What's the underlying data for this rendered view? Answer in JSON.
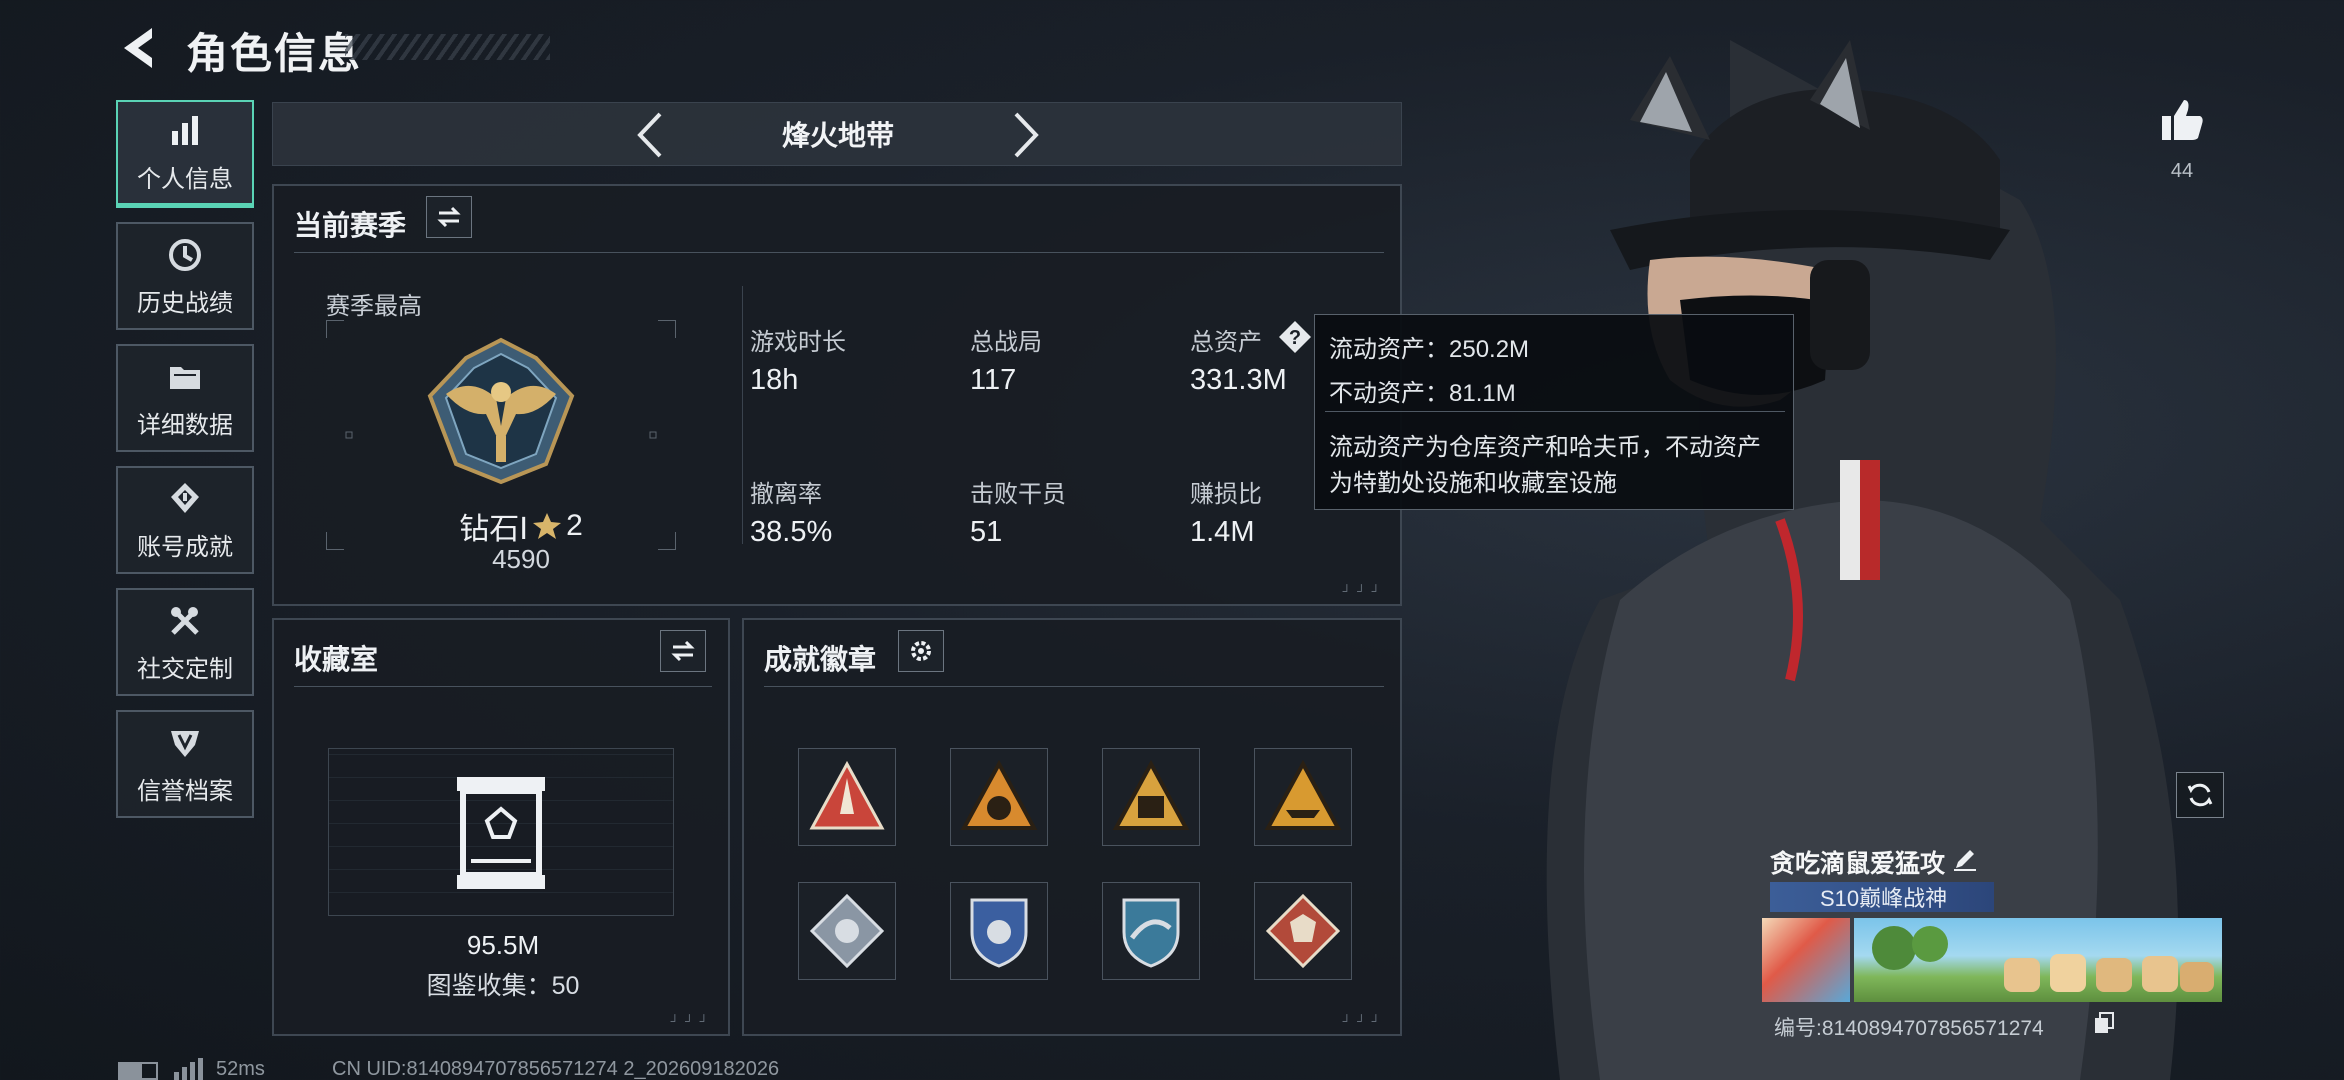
{
  "header": {
    "title": "角色信息"
  },
  "sidebar": {
    "items": [
      {
        "label": "个人信息",
        "icon": "bar-chart-icon",
        "active": true
      },
      {
        "label": "历史战绩",
        "icon": "clock-icon",
        "active": false
      },
      {
        "label": "详细数据",
        "icon": "folder-icon",
        "active": false
      },
      {
        "label": "账号成就",
        "icon": "medal-icon",
        "active": false
      },
      {
        "label": "社交定制",
        "icon": "tools-icon",
        "active": false
      },
      {
        "label": "信誉档案",
        "icon": "shield-icon",
        "active": false
      }
    ]
  },
  "mode_nav": {
    "title": "烽火地带"
  },
  "season": {
    "heading": "当前赛季",
    "best_label": "赛季最高",
    "rank_name": "钻石Ⅰ",
    "rank_stars": "2",
    "rank_score": "4590",
    "stats": [
      {
        "label": "游戏时长",
        "value": "18h"
      },
      {
        "label": "总战局",
        "value": "117"
      },
      {
        "label": "总资产",
        "value": "331.3M"
      },
      {
        "label": "撤离率",
        "value": "38.5%"
      },
      {
        "label": "击败干员",
        "value": "51"
      },
      {
        "label": "赚损比",
        "value": "1.4M"
      }
    ]
  },
  "tooltip": {
    "liquid": "流动资产：250.2M",
    "fixed": "不动资产：81.1M",
    "desc_line1": "流动资产为仓库资产和哈夫币，不动资产",
    "desc_line2": "为特勤处设施和收藏室设施"
  },
  "collection": {
    "heading": "收藏室",
    "value": "95.5M",
    "catalog": "图鉴收集：50"
  },
  "badges": {
    "heading": "成就徽章",
    "items": [
      {
        "icon": "rocket-triangle-badge",
        "color": "#c9453a"
      },
      {
        "icon": "emblem-triangle-badge",
        "color": "#d88a2e"
      },
      {
        "icon": "fortress-triangle-badge",
        "color": "#d8a23e"
      },
      {
        "icon": "ship-triangle-badge",
        "color": "#d89a30"
      },
      {
        "icon": "diamond-gear-badge",
        "color": "#8a96a4"
      },
      {
        "icon": "shield-crest-badge",
        "color": "#3b5fa0"
      },
      {
        "icon": "wing-shield-badge",
        "color": "#3b7a9a"
      },
      {
        "icon": "diamond-beast-badge",
        "color": "#b24a3a"
      }
    ]
  },
  "social": {
    "likes": "44",
    "nickname": "贪吃滴鼠爱猛攻",
    "title_badge": "S10巅峰战神",
    "uid_line": "编号:8140894707856571274"
  },
  "status": {
    "ping": "52ms",
    "cn_uid": "CN UID:8140894707856571274 2_202609182026"
  },
  "colors": {
    "accent": "#5ad3b5",
    "tooltip_bg": "#0a0d11"
  }
}
